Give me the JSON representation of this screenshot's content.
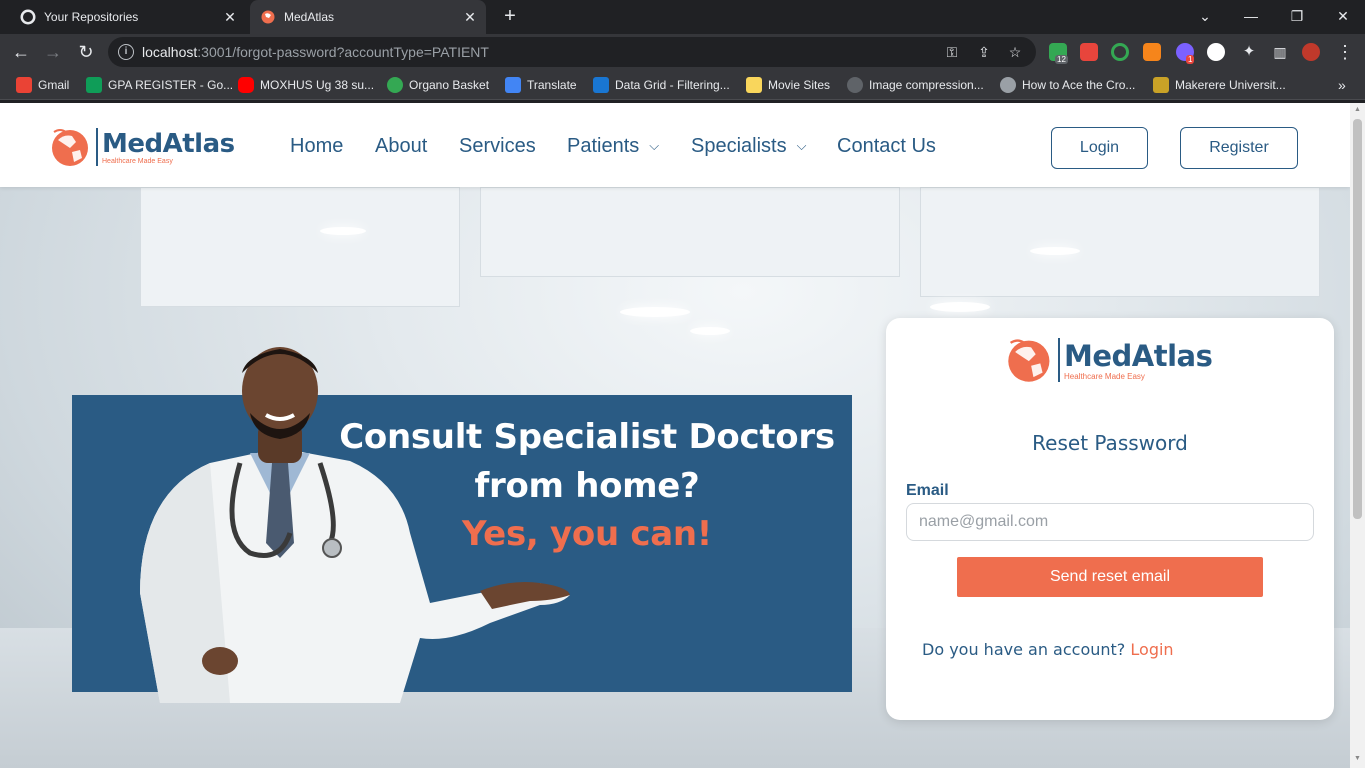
{
  "browser": {
    "tabs": [
      {
        "title": "Your Repositories",
        "active": false,
        "icon": "github-icon"
      },
      {
        "title": "MedAtlas",
        "active": true,
        "icon": "medatlas-favicon"
      }
    ],
    "url": {
      "host": "localhost",
      "rest": ":3001/forgot-password?accountType=PATIENT"
    },
    "bookmarks": [
      {
        "label": "Gmail",
        "color": "#ea4335"
      },
      {
        "label": "GPA REGISTER - Go...",
        "color": "#0f9d58"
      },
      {
        "label": "MOXHUS Ug 38 su...",
        "color": "#ff0000"
      },
      {
        "label": "Organo Basket",
        "color": "#34a853"
      },
      {
        "label": "Translate",
        "color": "#4285f4"
      },
      {
        "label": "Data Grid - Filtering...",
        "color": "#1976d2"
      },
      {
        "label": "Movie Sites",
        "color": "#f9d65c"
      },
      {
        "label": "Image compression...",
        "color": "#5f6368"
      },
      {
        "label": "How to Ace the Cro...",
        "color": "#9aa0a6"
      },
      {
        "label": "Makerere Universit...",
        "color": "#c9a227"
      }
    ],
    "ext_badges": {
      "shield": "12",
      "puzzle_alert": "1"
    }
  },
  "header": {
    "logo": {
      "name": "MedAtlas",
      "tagline": "Healthcare Made Easy"
    },
    "nav": [
      "Home",
      "About",
      "Services",
      "Patients",
      "Specialists",
      "Contact Us"
    ],
    "login_label": "Login",
    "register_label": "Register"
  },
  "hero": {
    "line1": "Consult Specialist Doctors",
    "line2": "from home?",
    "line3": "Yes, you can!"
  },
  "reset_card": {
    "logo_name": "MedAtlas",
    "logo_tagline": "Healthcare Made Easy",
    "title": "Reset Password",
    "email_label": "Email",
    "email_placeholder": "name@gmail.com",
    "email_value": "",
    "submit_label": "Send reset email",
    "account_prompt": "Do you have an account?",
    "login_link": "Login"
  },
  "colors": {
    "brand_blue": "#2a5b84",
    "brand_orange": "#ef6e4e"
  }
}
